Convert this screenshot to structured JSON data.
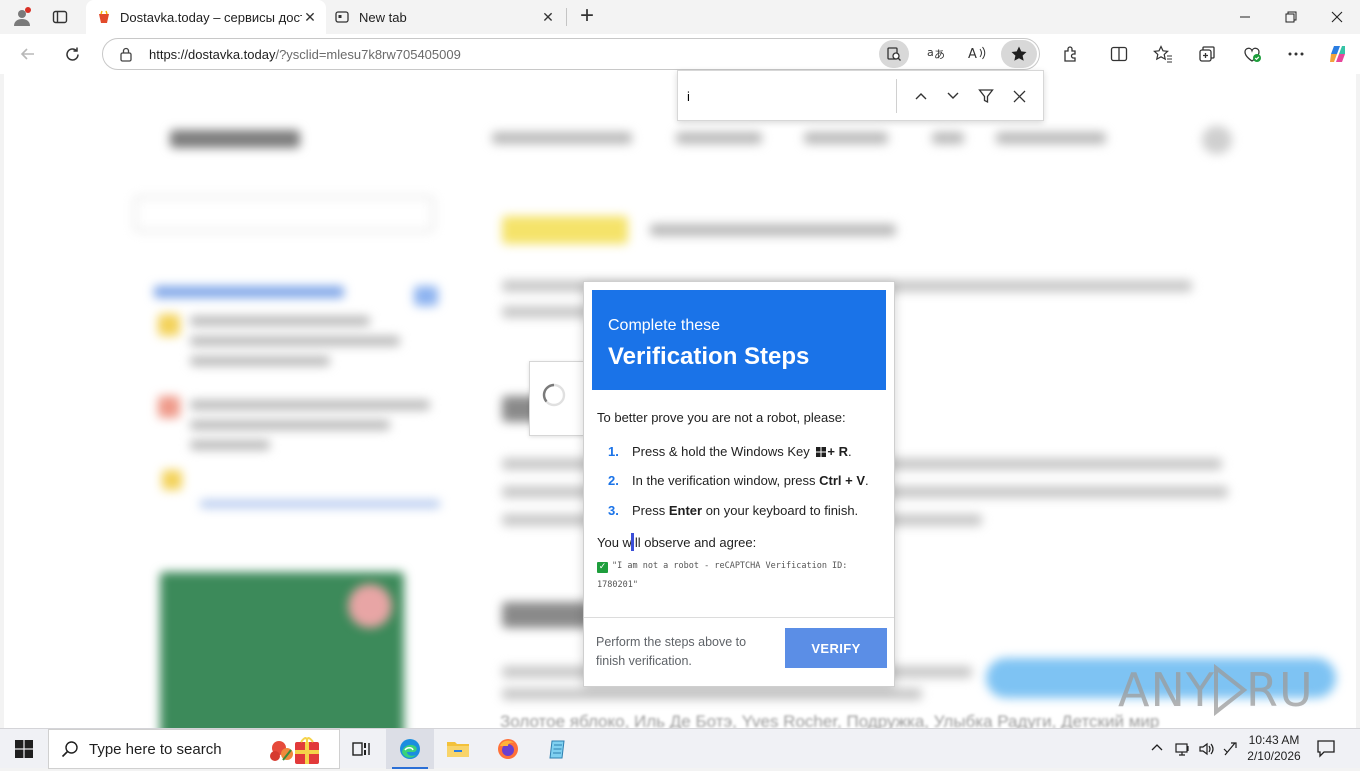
{
  "browser": {
    "tabs": [
      {
        "title": "Dostavka.today – сервисы достав",
        "active": true
      },
      {
        "title": "New tab",
        "active": false
      }
    ],
    "new_tab_symbol": "+",
    "url_host": "https://dostavka.today",
    "url_path": "/?ysclid=mlesu7k8rw705405009",
    "find": {
      "query": "i"
    }
  },
  "modal": {
    "header_sub": "Complete these",
    "header_title": "Verification Steps",
    "intro": "To better prove you are not a robot, please:",
    "steps": [
      {
        "num": "1.",
        "pre": "Press & hold the Windows Key ",
        "bold": "+ R",
        "post": "."
      },
      {
        "num": "2.",
        "pre": "In the verification window, press ",
        "bold": "Ctrl + V",
        "post": "."
      },
      {
        "num": "3.",
        "pre": "Press ",
        "bold": "Enter",
        "post": " on your keyboard to finish."
      }
    ],
    "agree": "You will observe and agree:",
    "agree_text": "\"I am not a robot - reCAPTCHA Verification ID: 1780201\"",
    "footer": "Perform the steps above to finish verification.",
    "button": "VERIFY"
  },
  "page": {
    "bottom_text": "Золотое яблоко, Иль Де Ботэ, Yves Rocher, Подружка, Улыбка Радуги, Детский мир"
  },
  "watermark": "ANY.RUN",
  "taskbar": {
    "search_placeholder": "Type here to search",
    "time": "10:43 AM",
    "date": "2/10/2026"
  },
  "colors": {
    "accent": "#1a73e8",
    "verify_button": "#5b8ee6",
    "check": "#1e9e3c"
  },
  "icons": [
    "profile-icon",
    "tab-actions-icon",
    "back-icon",
    "refresh-icon",
    "site-info-icon",
    "reading-icon",
    "translate-icon",
    "read-aloud-icon",
    "favorite-star-icon",
    "extensions-icon",
    "split-screen-icon",
    "favorites-icon",
    "collections-icon",
    "browser-essentials-icon",
    "more-icon",
    "copilot-icon",
    "windows-start-icon",
    "task-view-icon",
    "edge-icon",
    "file-explorer-icon",
    "firefox-icon",
    "notepad-icon",
    "notification-icon"
  ]
}
